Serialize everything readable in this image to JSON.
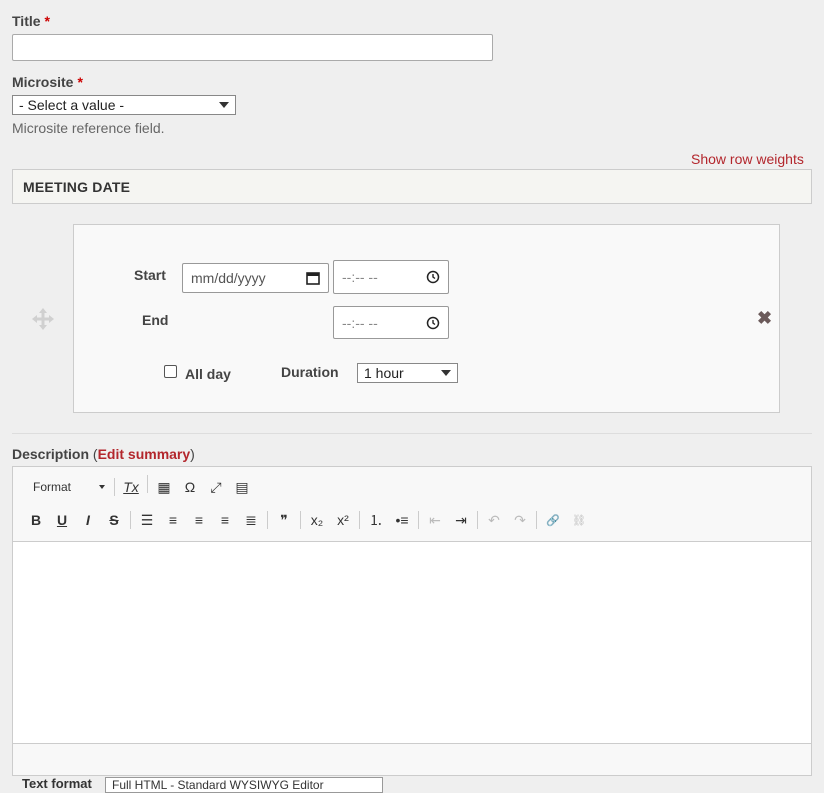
{
  "title_field": {
    "label": "Title",
    "required_mark": "*",
    "value": ""
  },
  "microsite_field": {
    "label": "Microsite",
    "required_mark": "*",
    "selected": "- Select a value -",
    "description": "Microsite reference field."
  },
  "show_row_weights": "Show row weights",
  "meeting_date": {
    "header": "MEETING DATE",
    "start_label": "Start",
    "end_label": "End",
    "start_date_placeholder": "mm/dd/yyyy",
    "start_time_placeholder": "--:-- --",
    "end_time_placeholder": "--:-- --",
    "all_day_label": "All day",
    "all_day_checked": false,
    "duration_label": "Duration",
    "duration_value": "1 hour"
  },
  "description_field": {
    "label": "Description",
    "paren_open": "(",
    "edit_summary": "Edit summary",
    "paren_close": ")"
  },
  "editor": {
    "format_label": "Format",
    "toolbar_row1": [
      {
        "name": "remove-format-icon",
        "glyph": "Tx"
      },
      {
        "name": "table-icon",
        "glyph": "▦"
      },
      {
        "name": "special-char-icon",
        "glyph": "Ω"
      },
      {
        "name": "maximize-icon",
        "glyph": "⤢"
      },
      {
        "name": "source-icon",
        "glyph": "▤"
      }
    ],
    "toolbar_row2": [
      {
        "name": "bold-icon",
        "glyph": "B"
      },
      {
        "name": "underline-icon",
        "glyph": "U"
      },
      {
        "name": "italic-icon",
        "glyph": "I"
      },
      {
        "name": "strikethrough-icon",
        "glyph": "S"
      },
      {
        "name": "horizontal-rule-icon",
        "glyph": "☰"
      },
      {
        "name": "align-left-icon",
        "glyph": "≡"
      },
      {
        "name": "align-center-icon",
        "glyph": "≡"
      },
      {
        "name": "align-right-icon",
        "glyph": "≡"
      },
      {
        "name": "justify-icon",
        "glyph": "≣"
      },
      {
        "name": "blockquote-icon",
        "glyph": "❞"
      },
      {
        "name": "subscript-icon",
        "glyph": "x₂"
      },
      {
        "name": "superscript-icon",
        "glyph": "x²"
      },
      {
        "name": "numbered-list-icon",
        "glyph": "⒈"
      },
      {
        "name": "bullet-list-icon",
        "glyph": "•≡"
      },
      {
        "name": "outdent-icon",
        "glyph": "⇤"
      },
      {
        "name": "indent-icon",
        "glyph": "⇥"
      },
      {
        "name": "undo-icon",
        "glyph": "↶"
      },
      {
        "name": "redo-icon",
        "glyph": "↷"
      },
      {
        "name": "link-icon",
        "glyph": "🔗"
      },
      {
        "name": "unlink-icon",
        "glyph": "⛓"
      }
    ]
  },
  "text_format": {
    "label": "Text format",
    "selected": "Full HTML - Standard WYSIWYG Editor"
  },
  "colors": {
    "link_red": "#b3262c",
    "required_red": "#cc0000"
  }
}
